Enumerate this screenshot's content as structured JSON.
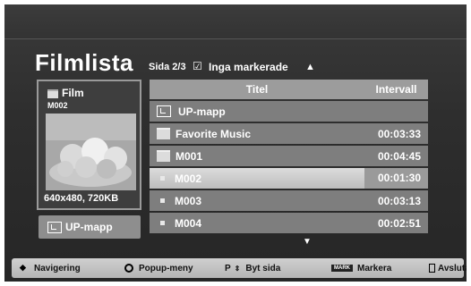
{
  "header": {
    "title": "Filmlista",
    "page_info": "Sida 2/3",
    "selection_status": "Inga markerade"
  },
  "preview": {
    "type_label": "Film",
    "item_code": "M002",
    "resolution": "640x480, 720KB",
    "up_button_label": "UP-mapp"
  },
  "table": {
    "col_title": "Titel",
    "col_interval": "Intervall",
    "rows": [
      {
        "name": "UP-mapp",
        "interval": "",
        "kind": "updir",
        "selected": false
      },
      {
        "name": "Favorite Music",
        "interval": "00:03:33",
        "kind": "folder",
        "selected": false
      },
      {
        "name": "M001",
        "interval": "00:04:45",
        "kind": "folder",
        "selected": false
      },
      {
        "name": "M002",
        "interval": "00:01:30",
        "kind": "file",
        "selected": true
      },
      {
        "name": "M003",
        "interval": "00:03:13",
        "kind": "file",
        "selected": false
      },
      {
        "name": "M004",
        "interval": "00:02:51",
        "kind": "file",
        "selected": false
      }
    ]
  },
  "footer": {
    "nav": "Navigering",
    "popup": "Popup-meny",
    "page_switch": "Byt sida",
    "page_key": "P",
    "mark_key": "MARK",
    "mark": "Markera",
    "exit": "Avsluta"
  },
  "colors": {
    "selected_row": "#d0d0d0",
    "row": "#7e7e7e",
    "header": "#9c9c9c"
  }
}
